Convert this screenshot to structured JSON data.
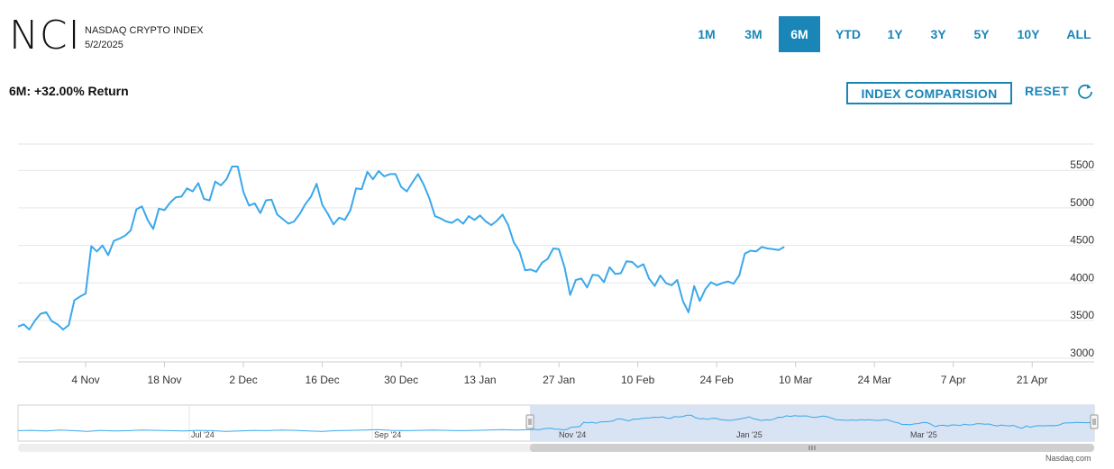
{
  "header": {
    "symbol": "NCI",
    "index_name": "NASDAQ CRYPTO INDEX",
    "date": "5/2/2025"
  },
  "ranges": [
    {
      "label": "1M",
      "active": false
    },
    {
      "label": "3M",
      "active": false
    },
    {
      "label": "6M",
      "active": true
    },
    {
      "label": "YTD",
      "active": false
    },
    {
      "label": "1Y",
      "active": false
    },
    {
      "label": "3Y",
      "active": false
    },
    {
      "label": "5Y",
      "active": false
    },
    {
      "label": "10Y",
      "active": false
    },
    {
      "label": "ALL",
      "active": false
    }
  ],
  "summary": {
    "return_text": "6M: +32.00% Return"
  },
  "actions": {
    "compare_label": "INDEX COMPARISION",
    "reset_label": "RESET",
    "reset_icon": "refresh-icon"
  },
  "colors": {
    "accent": "#1a86b8",
    "line": "#3aa8ec",
    "grid": "#e6e6e6",
    "navigator_fill": "#d8e3f3"
  },
  "chart_data": {
    "type": "line",
    "title": "",
    "xlabel": "",
    "ylabel": "",
    "ylim": [
      2950,
      5850
    ],
    "yticks": [
      3000,
      3500,
      4000,
      4500,
      5000,
      5500
    ],
    "xlim": [
      "2024-10-23",
      "2025-05-02"
    ],
    "xtick_labels": [
      {
        "label": "4 Nov",
        "date": "2024-11-04"
      },
      {
        "label": "18 Nov",
        "date": "2024-11-18"
      },
      {
        "label": "2 Dec",
        "date": "2024-12-02"
      },
      {
        "label": "16 Dec",
        "date": "2024-12-16"
      },
      {
        "label": "30 Dec",
        "date": "2024-12-30"
      },
      {
        "label": "13 Jan",
        "date": "2025-01-13"
      },
      {
        "label": "27 Jan",
        "date": "2025-01-27"
      },
      {
        "label": "10 Feb",
        "date": "2025-02-10"
      },
      {
        "label": "24 Feb",
        "date": "2025-02-24"
      },
      {
        "label": "10 Mar",
        "date": "2025-03-10"
      },
      {
        "label": "24 Mar",
        "date": "2025-03-24"
      },
      {
        "label": "7 Apr",
        "date": "2025-04-07"
      },
      {
        "label": "21 Apr",
        "date": "2025-04-21"
      }
    ],
    "grid": true,
    "legend": "none",
    "series": [
      {
        "points": [
          [
            "2024-10-23",
            3420
          ],
          [
            "2024-10-24",
            3450
          ],
          [
            "2024-10-25",
            3380
          ],
          [
            "2024-10-26",
            3500
          ],
          [
            "2024-10-27",
            3590
          ],
          [
            "2024-10-28",
            3610
          ],
          [
            "2024-10-29",
            3490
          ],
          [
            "2024-10-30",
            3450
          ],
          [
            "2024-10-31",
            3380
          ],
          [
            "2024-11-01",
            3440
          ],
          [
            "2024-11-02",
            3770
          ],
          [
            "2024-11-03",
            3820
          ],
          [
            "2024-11-04",
            3860
          ],
          [
            "2024-11-05",
            4490
          ],
          [
            "2024-11-06",
            4420
          ],
          [
            "2024-11-07",
            4500
          ],
          [
            "2024-11-08",
            4370
          ],
          [
            "2024-11-09",
            4560
          ],
          [
            "2024-11-10",
            4590
          ],
          [
            "2024-11-11",
            4630
          ],
          [
            "2024-11-12",
            4700
          ],
          [
            "2024-11-13",
            4980
          ],
          [
            "2024-11-14",
            5020
          ],
          [
            "2024-11-15",
            4840
          ],
          [
            "2024-11-16",
            4720
          ],
          [
            "2024-11-17",
            4990
          ],
          [
            "2024-11-18",
            4970
          ],
          [
            "2024-11-19",
            5070
          ],
          [
            "2024-11-20",
            5140
          ],
          [
            "2024-11-21",
            5150
          ],
          [
            "2024-11-22",
            5260
          ],
          [
            "2024-11-23",
            5220
          ],
          [
            "2024-11-24",
            5330
          ],
          [
            "2024-11-25",
            5120
          ],
          [
            "2024-11-26",
            5100
          ],
          [
            "2024-11-27",
            5350
          ],
          [
            "2024-11-28",
            5300
          ],
          [
            "2024-11-29",
            5380
          ],
          [
            "2024-11-30",
            5550
          ],
          [
            "2024-12-01",
            5550
          ],
          [
            "2024-12-02",
            5210
          ],
          [
            "2024-12-03",
            5030
          ],
          [
            "2024-12-04",
            5060
          ],
          [
            "2024-12-05",
            4930
          ],
          [
            "2024-12-06",
            5100
          ],
          [
            "2024-12-07",
            5110
          ],
          [
            "2024-12-08",
            4910
          ],
          [
            "2024-12-09",
            4850
          ],
          [
            "2024-12-10",
            4790
          ],
          [
            "2024-12-11",
            4820
          ],
          [
            "2024-12-12",
            4920
          ],
          [
            "2024-12-13",
            5050
          ],
          [
            "2024-12-14",
            5150
          ],
          [
            "2024-12-15",
            5320
          ],
          [
            "2024-12-16",
            5040
          ],
          [
            "2024-12-17",
            4920
          ],
          [
            "2024-12-18",
            4780
          ],
          [
            "2024-12-19",
            4870
          ],
          [
            "2024-12-20",
            4840
          ],
          [
            "2024-12-21",
            4970
          ],
          [
            "2024-12-22",
            5260
          ],
          [
            "2024-12-23",
            5250
          ],
          [
            "2024-12-24",
            5480
          ],
          [
            "2024-12-25",
            5380
          ],
          [
            "2024-12-26",
            5490
          ],
          [
            "2024-12-27",
            5420
          ],
          [
            "2024-12-28",
            5450
          ],
          [
            "2024-12-29",
            5450
          ],
          [
            "2024-12-30",
            5280
          ],
          [
            "2024-12-31",
            5220
          ],
          [
            "2025-01-01",
            5340
          ],
          [
            "2025-01-02",
            5450
          ],
          [
            "2025-01-03",
            5310
          ],
          [
            "2025-01-04",
            5130
          ],
          [
            "2025-01-05",
            4890
          ],
          [
            "2025-01-06",
            4860
          ],
          [
            "2025-01-07",
            4820
          ],
          [
            "2025-01-08",
            4800
          ],
          [
            "2025-01-09",
            4850
          ],
          [
            "2025-01-10",
            4790
          ],
          [
            "2025-01-11",
            4890
          ],
          [
            "2025-01-12",
            4840
          ],
          [
            "2025-01-13",
            4900
          ],
          [
            "2025-01-14",
            4820
          ],
          [
            "2025-01-15",
            4770
          ],
          [
            "2025-01-16",
            4830
          ],
          [
            "2025-01-17",
            4910
          ],
          [
            "2025-01-18",
            4770
          ],
          [
            "2025-01-19",
            4540
          ],
          [
            "2025-01-20",
            4420
          ],
          [
            "2025-01-21",
            4170
          ],
          [
            "2025-01-22",
            4180
          ],
          [
            "2025-01-23",
            4150
          ],
          [
            "2025-01-24",
            4270
          ],
          [
            "2025-01-25",
            4320
          ],
          [
            "2025-01-26",
            4460
          ],
          [
            "2025-01-27",
            4450
          ],
          [
            "2025-01-28",
            4210
          ],
          [
            "2025-01-29",
            3840
          ],
          [
            "2025-01-30",
            4040
          ],
          [
            "2025-01-31",
            4060
          ],
          [
            "2025-02-01",
            3940
          ],
          [
            "2025-02-02",
            4110
          ],
          [
            "2025-02-03",
            4100
          ],
          [
            "2025-02-04",
            4010
          ],
          [
            "2025-02-05",
            4210
          ],
          [
            "2025-02-06",
            4120
          ],
          [
            "2025-02-07",
            4130
          ],
          [
            "2025-02-08",
            4290
          ],
          [
            "2025-02-09",
            4280
          ],
          [
            "2025-02-10",
            4210
          ],
          [
            "2025-02-11",
            4250
          ],
          [
            "2025-02-12",
            4060
          ],
          [
            "2025-02-13",
            3960
          ],
          [
            "2025-02-14",
            4100
          ],
          [
            "2025-02-15",
            4000
          ],
          [
            "2025-02-16",
            3970
          ],
          [
            "2025-02-17",
            4040
          ],
          [
            "2025-02-18",
            3760
          ],
          [
            "2025-02-19",
            3610
          ],
          [
            "2025-02-20",
            3960
          ],
          [
            "2025-02-21",
            3760
          ],
          [
            "2025-02-22",
            3920
          ],
          [
            "2025-02-23",
            4010
          ],
          [
            "2025-02-24",
            3970
          ],
          [
            "2025-02-25",
            4000
          ],
          [
            "2025-02-26",
            4020
          ],
          [
            "2025-02-27",
            3990
          ],
          [
            "2025-02-28",
            4100
          ],
          [
            "2025-03-01",
            4390
          ],
          [
            "2025-03-02",
            4430
          ],
          [
            "2025-03-03",
            4420
          ],
          [
            "2025-03-04",
            4480
          ],
          [
            "2025-03-05",
            4460
          ],
          [
            "2025-03-06",
            4450
          ],
          [
            "2025-03-07",
            4440
          ],
          [
            "2025-03-08",
            4480
          ]
        ]
      }
    ]
  },
  "navigator": {
    "labels": [
      "Jul '24",
      "Sep '24",
      "Nov '24",
      "Jan '25",
      "Mar '25"
    ]
  },
  "credit": "Nasdaq.com"
}
